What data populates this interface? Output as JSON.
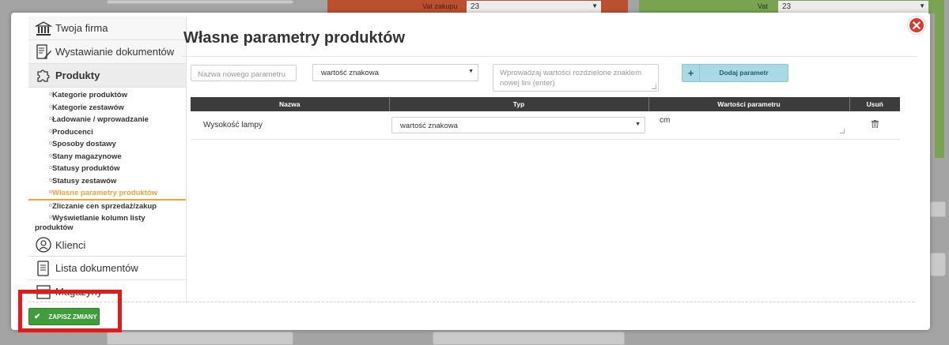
{
  "background": {
    "vat_zakupu_label": "Vat zakupu",
    "vat_zakupu_value": "23",
    "vat_label": "Vat",
    "vat_value": "23"
  },
  "sidebar": {
    "main_items": [
      {
        "label": "Twoja firma",
        "icon": "bank-icon"
      },
      {
        "label": "Wystawianie dokumentów",
        "icon": "document-edit-icon"
      },
      {
        "label": "Produkty",
        "icon": "puzzle-icon"
      }
    ],
    "sub_items": [
      {
        "label": "Kategorie produktów"
      },
      {
        "label": "Kategorie zestawów"
      },
      {
        "label": "Ładowanie / wprowadzanie"
      },
      {
        "label": "Producenci"
      },
      {
        "label": "Sposoby dostawy"
      },
      {
        "label": "Stany magazynowe"
      },
      {
        "label": "Statusy produktów"
      },
      {
        "label": "Statusy zestawów"
      },
      {
        "label": "Własne parametry produktów"
      },
      {
        "label": "Zliczanie cen sprzedaż/zakup"
      },
      {
        "label": "Wyświetlanie kolumn listy",
        "label2": "produktów"
      }
    ],
    "bottom_items": [
      {
        "label": "Klienci",
        "icon": "user-icon"
      },
      {
        "label": "Lista dokumentów",
        "icon": "document-list-icon"
      },
      {
        "label": "Magazyny",
        "icon": "warehouse-icon"
      }
    ]
  },
  "page": {
    "title": "Własne parametry produktów"
  },
  "form": {
    "name_placeholder": "Nazwa nowego parametru",
    "type_value": "wartość znakowa",
    "values_placeholder": "Wprowadzaj wartości rozdzielone znakiem nowej lini (enter)",
    "add_plus": "+",
    "add_label": "Dodaj parametr"
  },
  "table": {
    "headers": [
      "Nazwa",
      "Typ",
      "Wartości parametru",
      "Usuń"
    ],
    "rows": [
      {
        "name": "Wysokość lampy",
        "type": "wartość znakowa",
        "values": "cm"
      }
    ]
  },
  "footer": {
    "save_label": "ZAPISZ ZMIANY"
  },
  "colors": {
    "accent_orange": "#f0a43a",
    "save_green": "#3f9d3a",
    "add_button_blue": "#a8d9e4",
    "close_red": "#d63b30",
    "highlight_red": "#e4191c"
  }
}
